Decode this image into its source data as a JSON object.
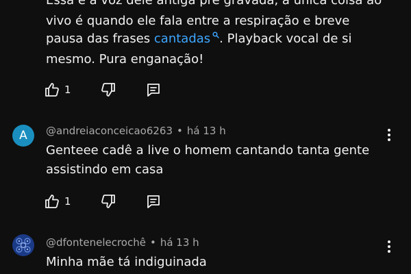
{
  "comment1": {
    "line0": "Essa é a voz dele antiga pré gravada, a única coisa ao",
    "line1": "vivo é quando ele fala entre a respiração e breve",
    "line2_pre": "pausa das frases",
    "line2_link": "cantadas",
    "line2_post": ". Playback vocal de si",
    "line3": "mesmo. Pura enganação!",
    "likes": "1"
  },
  "comment2": {
    "avatar_letter": "A",
    "avatar_color": "#1a8fbf",
    "author": "@andreiaconceicao6263",
    "separator": "•",
    "time": "há 13 h",
    "line1": "Genteee cadê a live o homem cantando tanta gente",
    "line2": "assistindo em casa",
    "likes": "1"
  },
  "comment3": {
    "author": "@dfontenelecrochê",
    "separator": "•",
    "time": "há 13 h",
    "line1": "Minha mãe tá indiguinada"
  },
  "icons": {
    "like": "thumbs-up-icon",
    "dislike": "thumbs-down-icon",
    "reply": "comment-icon",
    "menu": "more-vert-icon",
    "search": "search-icon"
  },
  "colors": {
    "background": "#0f0f0f",
    "text": "#f1f1f1",
    "meta": "#aaaaaa",
    "link": "#3ea6ff"
  }
}
